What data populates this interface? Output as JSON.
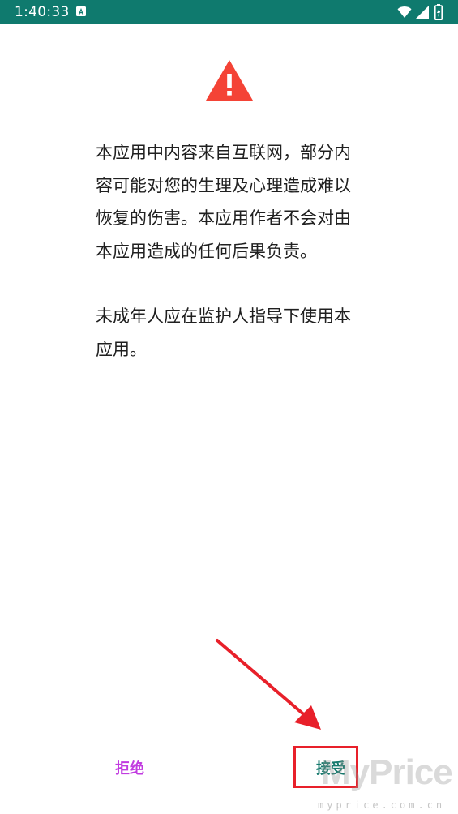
{
  "status_bar": {
    "time": "1:40:33",
    "background": "#0f7a6e"
  },
  "warning": {
    "icon": "warning-triangle-icon",
    "color": "#f44336"
  },
  "notice": {
    "paragraph_1": "本应用中内容来自互联网，部分内容可能对您的生理及心理造成难以恢复的伤害。本应用作者不会对由本应用造成的任何后果负责。",
    "paragraph_2": "未成年人应在监护人指导下使用本应用。"
  },
  "actions": {
    "reject_label": "拒绝",
    "accept_label": "接受",
    "reject_color": "#c13be0",
    "accept_color": "#177a6e"
  },
  "watermark": {
    "brand": "MyPrice",
    "url": "myprice.com.cn"
  }
}
